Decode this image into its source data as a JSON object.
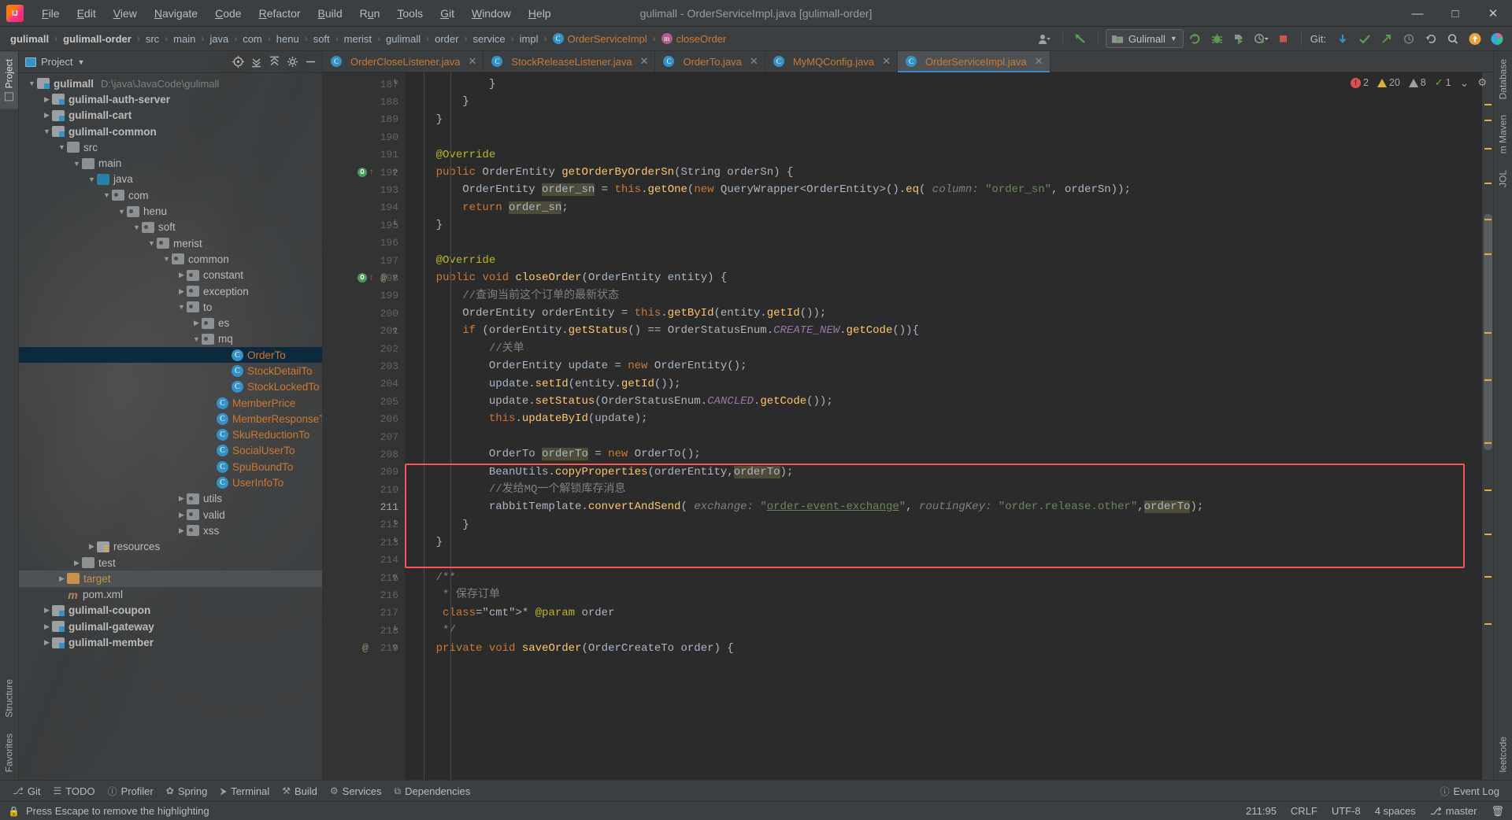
{
  "window": {
    "title": "gulimall - OrderServiceImpl.java [gulimall-order]",
    "minimize": "—",
    "maximize": "□",
    "close": "✕"
  },
  "menu": {
    "items": [
      {
        "label": "File",
        "mnemonic": "F"
      },
      {
        "label": "Edit",
        "mnemonic": "E"
      },
      {
        "label": "View",
        "mnemonic": "V"
      },
      {
        "label": "Navigate",
        "mnemonic": "N"
      },
      {
        "label": "Code",
        "mnemonic": "C"
      },
      {
        "label": "Refactor",
        "mnemonic": "R"
      },
      {
        "label": "Build",
        "mnemonic": "B"
      },
      {
        "label": "Run",
        "mnemonic": "u"
      },
      {
        "label": "Tools",
        "mnemonic": "T"
      },
      {
        "label": "Git",
        "mnemonic": "G"
      },
      {
        "label": "Window",
        "mnemonic": "W"
      },
      {
        "label": "Help",
        "mnemonic": "H"
      }
    ]
  },
  "navbar": {
    "crumbs": [
      {
        "label": "gulimall",
        "style": "bold"
      },
      {
        "label": "gulimall-order",
        "style": "bold"
      },
      {
        "label": "src",
        "style": "plain"
      },
      {
        "label": "main",
        "style": "plain"
      },
      {
        "label": "java",
        "style": "plain"
      },
      {
        "label": "com",
        "style": "plain"
      },
      {
        "label": "henu",
        "style": "plain"
      },
      {
        "label": "soft",
        "style": "plain"
      },
      {
        "label": "merist",
        "style": "plain"
      },
      {
        "label": "gulimall",
        "style": "plain"
      },
      {
        "label": "order",
        "style": "plain"
      },
      {
        "label": "service",
        "style": "plain"
      },
      {
        "label": "impl",
        "style": "plain"
      },
      {
        "label": "OrderServiceImpl",
        "style": "class",
        "icon": "class-icon"
      },
      {
        "label": "closeOrder",
        "style": "class",
        "icon": "method-icon"
      }
    ],
    "run_config": "Gulimall",
    "git_label": "Git:",
    "separator": "›"
  },
  "project_panel": {
    "title": "Project",
    "tree": [
      {
        "depth": 0,
        "arrow": "down",
        "icon": "module",
        "label": "gulimall",
        "bold": true,
        "path": "D:\\java\\JavaCode\\gulimall"
      },
      {
        "depth": 1,
        "arrow": "right",
        "icon": "module",
        "label": "gulimall-auth-server",
        "bold": true
      },
      {
        "depth": 1,
        "arrow": "right",
        "icon": "module",
        "label": "gulimall-cart",
        "bold": true
      },
      {
        "depth": 1,
        "arrow": "down",
        "icon": "module",
        "label": "gulimall-common",
        "bold": true
      },
      {
        "depth": 2,
        "arrow": "down",
        "icon": "folder",
        "label": "src"
      },
      {
        "depth": 3,
        "arrow": "down",
        "icon": "folder",
        "label": "main"
      },
      {
        "depth": 4,
        "arrow": "down",
        "icon": "source",
        "label": "java"
      },
      {
        "depth": 5,
        "arrow": "down",
        "icon": "package",
        "label": "com"
      },
      {
        "depth": 6,
        "arrow": "down",
        "icon": "package",
        "label": "henu"
      },
      {
        "depth": 7,
        "arrow": "down",
        "icon": "package",
        "label": "soft"
      },
      {
        "depth": 8,
        "arrow": "down",
        "icon": "package",
        "label": "merist"
      },
      {
        "depth": 9,
        "arrow": "down",
        "icon": "package",
        "label": "common"
      },
      {
        "depth": 10,
        "arrow": "right",
        "icon": "package",
        "label": "constant"
      },
      {
        "depth": 10,
        "arrow": "right",
        "icon": "package",
        "label": "exception"
      },
      {
        "depth": 10,
        "arrow": "down",
        "icon": "package",
        "label": "to"
      },
      {
        "depth": 11,
        "arrow": "right",
        "icon": "package",
        "label": "es"
      },
      {
        "depth": 11,
        "arrow": "down",
        "icon": "package",
        "label": "mq"
      },
      {
        "depth": 13,
        "arrow": "none",
        "icon": "class",
        "label": "OrderTo",
        "cls": true,
        "selected": true
      },
      {
        "depth": 13,
        "arrow": "none",
        "icon": "class",
        "label": "StockDetailTo",
        "cls": true
      },
      {
        "depth": 13,
        "arrow": "none",
        "icon": "class",
        "label": "StockLockedTo",
        "cls": true
      },
      {
        "depth": 12,
        "arrow": "none",
        "icon": "class",
        "label": "MemberPrice",
        "cls": true
      },
      {
        "depth": 12,
        "arrow": "none",
        "icon": "class",
        "label": "MemberResponseTo",
        "cls": true
      },
      {
        "depth": 12,
        "arrow": "none",
        "icon": "class",
        "label": "SkuReductionTo",
        "cls": true
      },
      {
        "depth": 12,
        "arrow": "none",
        "icon": "class",
        "label": "SocialUserTo",
        "cls": true
      },
      {
        "depth": 12,
        "arrow": "none",
        "icon": "class",
        "label": "SpuBoundTo",
        "cls": true
      },
      {
        "depth": 12,
        "arrow": "none",
        "icon": "class",
        "label": "UserInfoTo",
        "cls": true
      },
      {
        "depth": 10,
        "arrow": "right",
        "icon": "package",
        "label": "utils"
      },
      {
        "depth": 10,
        "arrow": "right",
        "icon": "package",
        "label": "valid"
      },
      {
        "depth": 10,
        "arrow": "right",
        "icon": "package",
        "label": "xss"
      },
      {
        "depth": 4,
        "arrow": "right",
        "icon": "resources",
        "label": "resources"
      },
      {
        "depth": 3,
        "arrow": "right",
        "icon": "folder",
        "label": "test"
      },
      {
        "depth": 2,
        "arrow": "right",
        "icon": "target",
        "label": "target",
        "tgt": true,
        "highlight": true
      },
      {
        "depth": 2,
        "arrow": "none",
        "icon": "maven",
        "label": "pom.xml"
      },
      {
        "depth": 1,
        "arrow": "right",
        "icon": "module",
        "label": "gulimall-coupon",
        "bold": true
      },
      {
        "depth": 1,
        "arrow": "right",
        "icon": "module",
        "label": "gulimall-gateway",
        "bold": true
      },
      {
        "depth": 1,
        "arrow": "right",
        "icon": "module",
        "label": "gulimall-member",
        "bold": true
      }
    ]
  },
  "editor": {
    "tabs": [
      {
        "label": "OrderCloseListener.java",
        "active": false
      },
      {
        "label": "StockReleaseListener.java",
        "active": false
      },
      {
        "label": "OrderTo.java",
        "active": false
      },
      {
        "label": "MyMQConfig.java",
        "active": false
      },
      {
        "label": "OrderServiceImpl.java",
        "active": true
      }
    ],
    "inspections": {
      "errors": "2",
      "warnings": "20",
      "weak_warnings": "8",
      "typos": "1",
      "chevron": "⌄",
      "gear": "⚙"
    },
    "lines": [
      {
        "num": "187",
        "fold": "end"
      },
      {
        "num": "188",
        "fold": "none"
      },
      {
        "num": "189",
        "fold": "none"
      },
      {
        "num": "190",
        "fold": "none"
      },
      {
        "num": "191",
        "fold": "none"
      },
      {
        "num": "192",
        "fold": "start",
        "marker": "override-run"
      },
      {
        "num": "193",
        "fold": "none"
      },
      {
        "num": "194",
        "fold": "none"
      },
      {
        "num": "195",
        "fold": "end"
      },
      {
        "num": "196",
        "fold": "none"
      },
      {
        "num": "197",
        "fold": "none"
      },
      {
        "num": "198",
        "fold": "start",
        "marker": "override-at"
      },
      {
        "num": "199",
        "fold": "none"
      },
      {
        "num": "200",
        "fold": "none"
      },
      {
        "num": "201",
        "fold": "start"
      },
      {
        "num": "202",
        "fold": "none"
      },
      {
        "num": "203",
        "fold": "none"
      },
      {
        "num": "204",
        "fold": "none"
      },
      {
        "num": "205",
        "fold": "none"
      },
      {
        "num": "206",
        "fold": "none"
      },
      {
        "num": "207",
        "fold": "none"
      },
      {
        "num": "208",
        "fold": "none"
      },
      {
        "num": "209",
        "fold": "none"
      },
      {
        "num": "210",
        "fold": "none"
      },
      {
        "num": "211",
        "fold": "none",
        "current": true
      },
      {
        "num": "212",
        "fold": "end"
      },
      {
        "num": "213",
        "fold": "end"
      },
      {
        "num": "214",
        "fold": "none"
      },
      {
        "num": "215",
        "fold": "start"
      },
      {
        "num": "216",
        "fold": "none"
      },
      {
        "num": "217",
        "fold": "none"
      },
      {
        "num": "218",
        "fold": "end"
      },
      {
        "num": "219",
        "fold": "start",
        "marker": "at"
      }
    ],
    "code": [
      "            }",
      "        }",
      "    }",
      "",
      "    @Override",
      "    public OrderEntity getOrderByOrderSn(String orderSn) {",
      "        OrderEntity order_sn = this.getOne(new QueryWrapper<OrderEntity>().eq( column: \"order_sn\", orderSn));",
      "        return order_sn;",
      "    }",
      "",
      "    @Override",
      "    public void closeOrder(OrderEntity entity) {",
      "        //查询当前这个订单的最新状态",
      "        OrderEntity orderEntity = this.getById(entity.getId());",
      "        if (orderEntity.getStatus() == OrderStatusEnum.CREATE_NEW.getCode()){",
      "            //关单",
      "            OrderEntity update = new OrderEntity();",
      "            update.setId(entity.getId());",
      "            update.setStatus(OrderStatusEnum.CANCLED.getCode());",
      "            this.updateById(update);",
      "",
      "            OrderTo orderTo = new OrderTo();",
      "            BeanUtils.copyProperties(orderEntity,orderTo);",
      "            //发给MQ一个解锁库存消息",
      "            rabbitTemplate.convertAndSend( exchange: \"order-event-exchange\", routingKey: \"order.release.other\",orderTo);",
      "        }",
      "    }",
      "",
      "    /**",
      "     * 保存订单",
      "     * @param order",
      "     */",
      "    private void saveOrder(OrderCreateTo order) {"
    ]
  },
  "tool_windows": {
    "left_vertical": [
      {
        "label": "Project",
        "selected": true
      },
      {
        "label": "Structure",
        "selected": false
      },
      {
        "label": "Favorites",
        "selected": false
      }
    ],
    "right_vertical": [
      {
        "label": "Database"
      },
      {
        "label": "m Maven"
      },
      {
        "label": "JOL"
      },
      {
        "label": "leetcode"
      }
    ],
    "bottom": [
      {
        "label": "Git",
        "icon": "git-icon"
      },
      {
        "label": "TODO",
        "icon": "todo-icon"
      },
      {
        "label": "Profiler",
        "icon": "profiler-icon"
      },
      {
        "label": "Spring",
        "icon": "spring-icon"
      },
      {
        "label": "Terminal",
        "icon": "terminal-icon"
      },
      {
        "label": "Build",
        "icon": "build-icon"
      },
      {
        "label": "Services",
        "icon": "services-icon"
      },
      {
        "label": "Dependencies",
        "icon": "dependencies-icon"
      }
    ],
    "event_log": "Event Log"
  },
  "statusbar": {
    "message": "Press Escape to remove the highlighting",
    "caret": "211:95",
    "line_sep": "CRLF",
    "encoding": "UTF-8",
    "indent": "4 spaces",
    "branch": "master",
    "lock_icon": "🔒",
    "branch_icon": "⎇"
  }
}
